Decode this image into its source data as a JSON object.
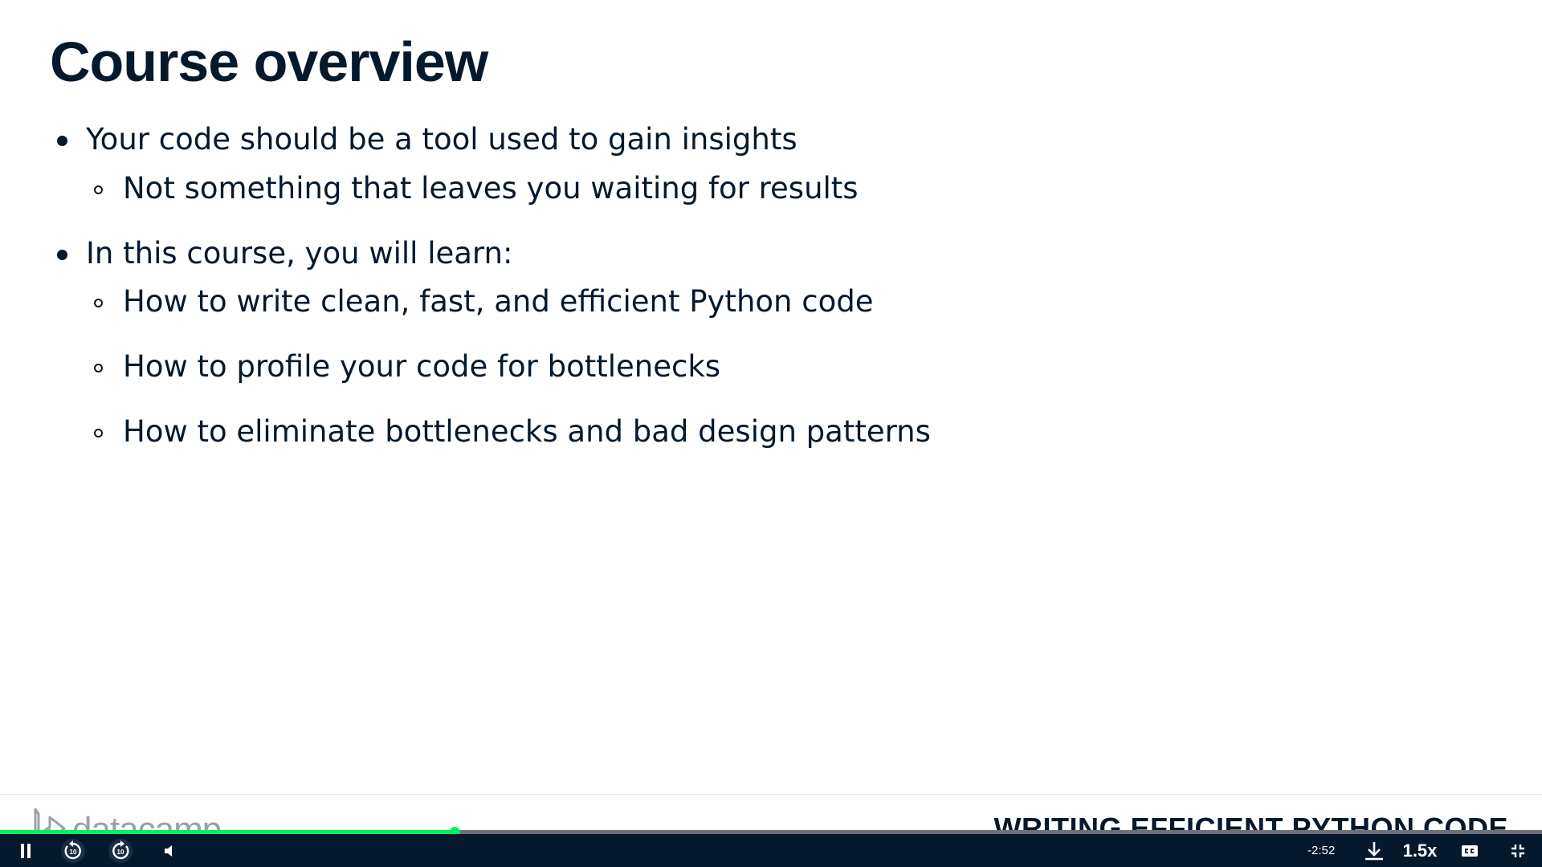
{
  "slide": {
    "title": "Course overview",
    "lines": [
      {
        "level": 1,
        "text": "Your code should be a tool used to gain insights"
      },
      {
        "level": 2,
        "text": "Not something that leaves you waiting for results"
      },
      {
        "level": 1,
        "text": "In this course, you will learn:"
      },
      {
        "level": 2,
        "text": "How to write clean, fast, and efficient Python code"
      },
      {
        "level": 2,
        "text": "How to profile your code for bottlenecks"
      },
      {
        "level": 2,
        "text": "How to eliminate bottlenecks and bad design patterns"
      }
    ]
  },
  "footer": {
    "logo_text": "datacamp",
    "course_name": "WRITING EFFICIENT PYTHON CODE"
  },
  "player": {
    "progress_percent": 29.5,
    "time_remaining": "-2:52",
    "speed": "1.5x",
    "rewind_seconds": "10",
    "forward_seconds": "10",
    "icons": {
      "pause": "pause-icon",
      "rewind": "rewind-10-icon",
      "forward": "forward-10-icon",
      "volume": "volume-icon",
      "download": "download-icon",
      "captions": "captions-icon",
      "exit_fullscreen": "exit-fullscreen-icon"
    },
    "colors": {
      "bar_background": "#05192d",
      "progress": "#03ef62",
      "track": "#6c7079"
    }
  }
}
